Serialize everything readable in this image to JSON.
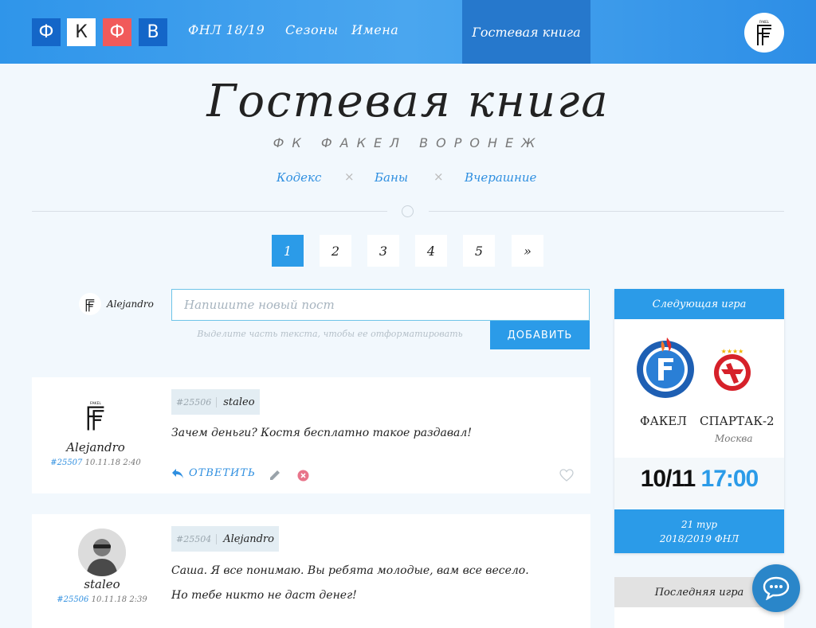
{
  "header": {
    "logo_letters": [
      "Ф",
      "К",
      "Ф",
      "В"
    ],
    "logo_colors": [
      "#1466c8",
      "#ffffff",
      "#f15a5a",
      "#1466c8"
    ],
    "nav": [
      "ФНЛ 18/19",
      "Сезоны",
      "Имена",
      "Гостевая книга"
    ],
    "avatar_icon": "fakel-logo-icon"
  },
  "page": {
    "title": "Гостевая книга",
    "subtitle": "ФК ФАКЕЛ ВОРОНЕЖ",
    "links": [
      "Кодекс",
      "Баны",
      "Вчерашние"
    ],
    "separator": "×"
  },
  "pagination": {
    "pages": [
      "1",
      "2",
      "3",
      "4",
      "5"
    ],
    "next": "»",
    "current": "1"
  },
  "composer": {
    "user": "Alejandro",
    "placeholder": "Напишите новый пост",
    "hint": "Выделите часть текста, чтобы ее отформатировать",
    "submit": "ДОБАВИТЬ"
  },
  "posts": [
    {
      "author": "Alejandro",
      "num": "#25507",
      "date": "10.11.18 2:40",
      "reply_num": "#25506",
      "reply_name": "staleo",
      "lines": [
        "Зачем деньги? Костя бесплатно такое раздавал!"
      ],
      "reply_label": "ОТВЕТИТЬ"
    },
    {
      "author": "staleo",
      "num": "#25506",
      "date": "10.11.18 2:39",
      "reply_num": "#25504",
      "reply_name": "Alejandro",
      "lines": [
        "Саша. Я все понимаю. Вы ребята молодые, вам все весело.",
        "Но тебе никто не даст денег!"
      ]
    }
  ],
  "next_game": {
    "title": "Следующая игра",
    "home": "ФАКЕЛ",
    "away": "СПАРТАК-2",
    "away_city": "Москва",
    "date": "10/11",
    "time": "17:00",
    "round": "21 тур",
    "season": "2018/2019 ФНЛ",
    "colors": {
      "accent": "#2b9be8",
      "spartak_red": "#d6212a"
    }
  },
  "last_game": {
    "title": "Последняя игра"
  }
}
